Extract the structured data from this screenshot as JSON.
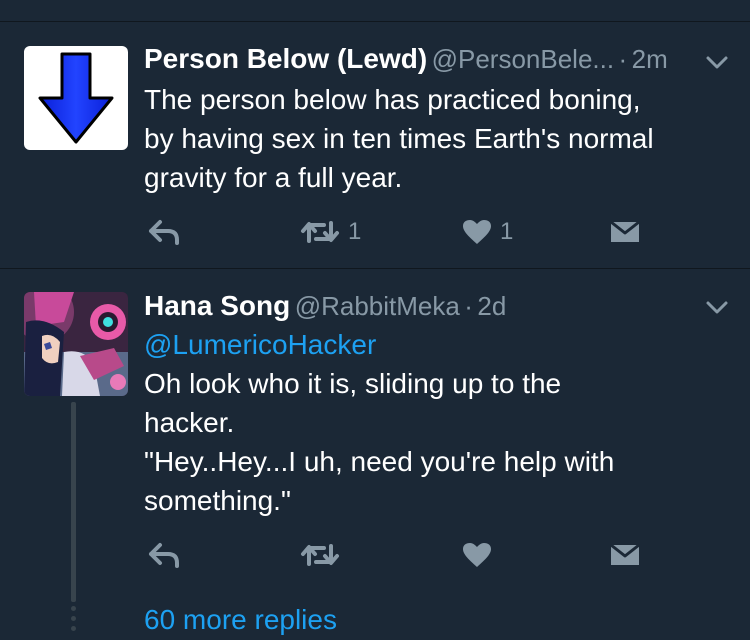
{
  "tweets": [
    {
      "name": "Person Below (Lewd)",
      "handle": "@PersonBele...",
      "separator": "·",
      "time": "2m",
      "avatar_icon": "down-arrow-icon",
      "lines": [
        "The person below has practiced boning,",
        "by having sex in ten times Earth's normal",
        "gravity for a full year."
      ],
      "actions": {
        "retweet_count": "1",
        "like_count": "1"
      }
    },
    {
      "name": "Hana Song",
      "handle": "@RabbitMeka",
      "separator": "·",
      "time": "2d",
      "avatar_icon": "anime-character-avatar",
      "mention": "@LumericoHacker",
      "lines": [
        "Oh look who it is, sliding up to the",
        "hacker.",
        "\"Hey..Hey...I uh, need you're help with",
        "something.\""
      ],
      "actions": {
        "retweet_count": "",
        "like_count": ""
      }
    }
  ],
  "more_replies": "60 more replies",
  "colors": {
    "background": "#1b2836",
    "divider": "#10171e",
    "secondary_text": "#8899a6",
    "link": "#1da1f2",
    "arrow_blue": "#0022ff"
  }
}
